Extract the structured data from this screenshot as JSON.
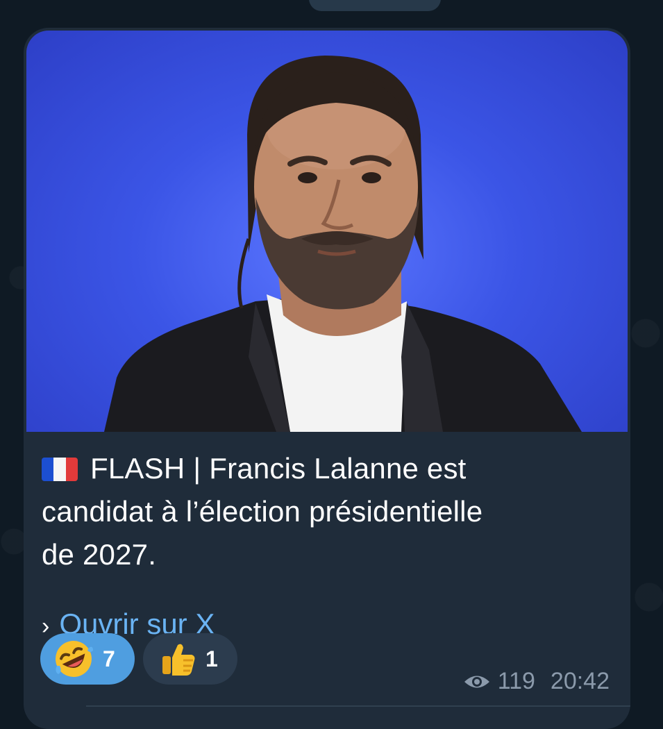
{
  "post": {
    "caption_title": "FLASH | Francis Lalanne est",
    "caption_line2": "candidat à l’élection présidentielle",
    "caption_line3": "de 2027.",
    "link_prefix": "›",
    "link_label": "Ouvrir sur X",
    "flag_icon": "france-flag-icon"
  },
  "reactions": [
    {
      "emoji_name": "rolling-on-floor-laughing-emoji",
      "count": "7",
      "selected": true
    },
    {
      "emoji_name": "thumbs-up-emoji",
      "count": "1",
      "selected": false
    }
  ],
  "meta": {
    "views": "119",
    "time": "20:42"
  },
  "colors": {
    "bubble": "#1f2c3a",
    "link": "#6ab3f3",
    "reaction_selected": "#4f9ee0",
    "reaction_default": "#2c3c4e",
    "meta_text": "#8b9aab",
    "photo_backdrop": "#3b55e6"
  }
}
